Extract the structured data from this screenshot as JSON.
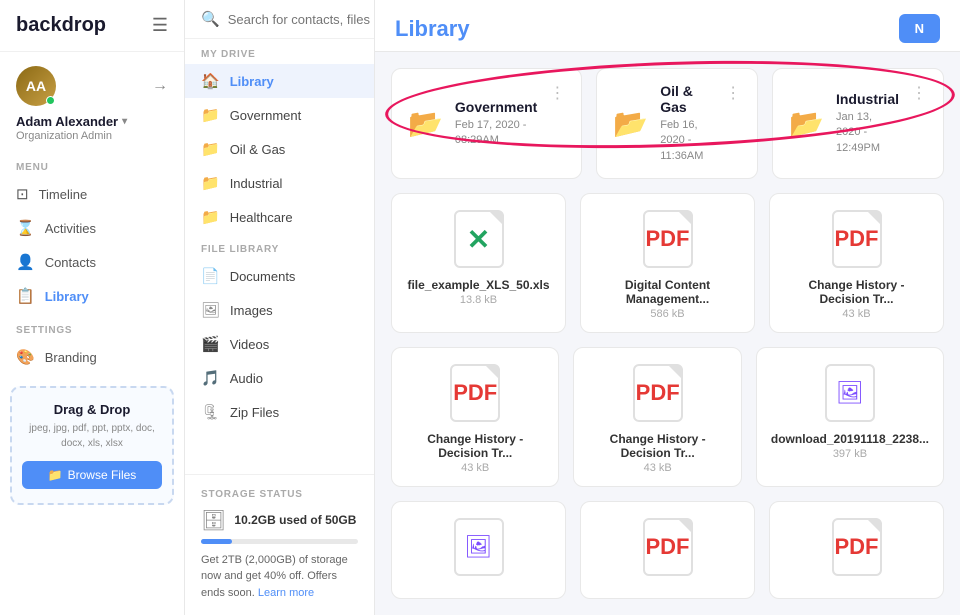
{
  "app": {
    "name": "backdrop"
  },
  "search": {
    "placeholder": "Search for contacts, files or spaces..."
  },
  "user": {
    "name": "Adam Alexander",
    "role": "Organization Admin",
    "initials": "AA"
  },
  "leftNav": {
    "menu_label": "MENU",
    "settings_label": "SETTINGS",
    "items": [
      {
        "id": "timeline",
        "label": "Timeline"
      },
      {
        "id": "activities",
        "label": "Activities"
      },
      {
        "id": "contacts",
        "label": "Contacts"
      },
      {
        "id": "library",
        "label": "Library"
      }
    ],
    "settings_items": [
      {
        "id": "branding",
        "label": "Branding"
      }
    ]
  },
  "dragDrop": {
    "title": "Drag & Drop",
    "formats": "jpeg, jpg, pdf, ppt, pptx,\ndoc, docx, xls, xlsx",
    "button_label": "Browse Files"
  },
  "middleNav": {
    "my_drive_label": "MY DRIVE",
    "file_library_label": "FILE LIBRARY",
    "storage_status_label": "STORAGE STATUS",
    "my_drive_items": [
      {
        "id": "library",
        "label": "Library",
        "active": true
      },
      {
        "id": "government",
        "label": "Government"
      },
      {
        "id": "oil-gas",
        "label": "Oil & Gas"
      },
      {
        "id": "industrial",
        "label": "Industrial"
      },
      {
        "id": "healthcare",
        "label": "Healthcare"
      }
    ],
    "file_library_items": [
      {
        "id": "documents",
        "label": "Documents"
      },
      {
        "id": "images",
        "label": "Images"
      },
      {
        "id": "videos",
        "label": "Videos"
      },
      {
        "id": "audio",
        "label": "Audio"
      },
      {
        "id": "zip-files",
        "label": "Zip Files"
      }
    ],
    "storage": {
      "used": "10.2GB used of 50GB",
      "percent": 20,
      "promo": "Get 2TB (2,000GB) of storage now and get 40% off. Offers ends soon. Learn more"
    }
  },
  "main": {
    "title": "Library",
    "new_button_label": "N",
    "folders": [
      {
        "name": "Government",
        "date": "Feb 17, 2020 -\n08:29AM"
      },
      {
        "name": "Oil & Gas",
        "date": "Feb 16, 2020 -\n11:36AM"
      },
      {
        "name": "Industrial",
        "date": "Jan 13, 2020 -\n12:49PM"
      }
    ],
    "files_row1": [
      {
        "name": "file_example_XLS_50.xls",
        "size": "13.8 kB",
        "type": "xls"
      },
      {
        "name": "Digital Content Management...",
        "size": "586 kB",
        "type": "pdf"
      },
      {
        "name": "Change History - Decision Tr...",
        "size": "43 kB",
        "type": "pdf-red"
      }
    ],
    "files_row2": [
      {
        "name": "Change History - Decision Tr...",
        "size": "43 kB",
        "type": "pdf"
      },
      {
        "name": "Change History - Decision Tr...",
        "size": "43 kB",
        "type": "pdf"
      },
      {
        "name": "download_20191118_2238...",
        "size": "397 kB",
        "type": "img"
      }
    ],
    "files_row3": [
      {
        "name": "",
        "size": "",
        "type": "img"
      },
      {
        "name": "",
        "size": "",
        "type": "pdf"
      },
      {
        "name": "",
        "size": "",
        "type": "pdf-red"
      }
    ]
  }
}
